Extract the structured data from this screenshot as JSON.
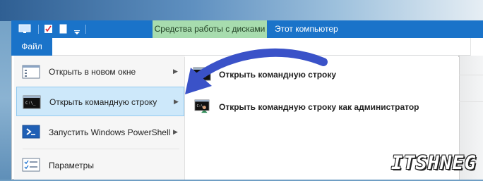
{
  "titlebar": {
    "context_tab": "Средства работы с дисками",
    "title": "Этот компьютер"
  },
  "ribbon": {
    "file_tab": "Файл"
  },
  "menu": {
    "items": [
      {
        "label": "Открыть в новом окне",
        "icon": "window-icon",
        "has_submenu": true
      },
      {
        "label": "Открыть командную строку",
        "icon": "cmd-icon",
        "has_submenu": true,
        "selected": true
      },
      {
        "label": "Запустить Windows PowerShell",
        "icon": "powershell-icon",
        "has_submenu": true
      },
      {
        "label": "Параметры",
        "icon": "settings-icon",
        "has_submenu": false
      }
    ],
    "submenu": [
      {
        "label": "Открыть командную строку",
        "icon": "cmd-icon"
      },
      {
        "label": "Открыть командную строку как администратор",
        "icon": "cmd-admin-icon"
      }
    ]
  },
  "watermark": "ITSHNEG",
  "colors": {
    "accent": "#1a73c9",
    "context_tab": "#a7dcae",
    "selection": "#cde8fa",
    "annotation_arrow": "#3a52c8"
  }
}
